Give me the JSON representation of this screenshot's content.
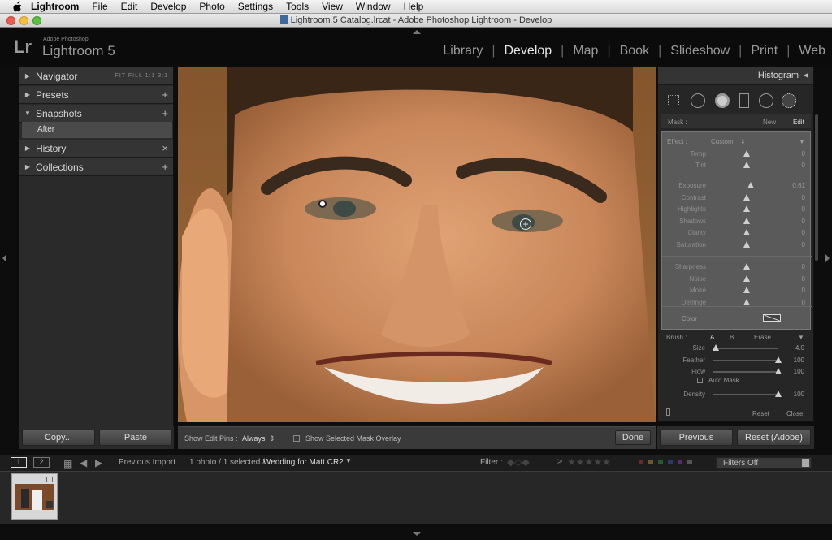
{
  "menubar": {
    "app": "Lightroom",
    "items": [
      "File",
      "Edit",
      "Develop",
      "Photo",
      "Settings",
      "Tools",
      "View",
      "Window",
      "Help"
    ]
  },
  "window": {
    "title": "Lightroom 5 Catalog.lrcat - Adobe Photoshop Lightroom - Develop"
  },
  "logo": {
    "lr": "Lr",
    "sub": "Adobe Photoshop",
    "main": "Lightroom 5"
  },
  "modules": [
    "Library",
    "Develop",
    "Map",
    "Book",
    "Slideshow",
    "Print",
    "Web"
  ],
  "left_panel": {
    "navigator": "Navigator",
    "navigator_opts": "FIT  FILL  1:1  3:1",
    "presets": "Presets",
    "snapshots": "Snapshots",
    "snapshot_item": "After",
    "history": "History",
    "collections": "Collections",
    "copy_label": "Copy...",
    "paste_label": "Paste"
  },
  "right_panel": {
    "histogram": "Histogram",
    "mask_label": "Mask :",
    "mask_new": "New",
    "mask_edit": "Edit",
    "effect_label": "Effect :",
    "effect_value": "Custom",
    "sliders1": [
      {
        "label": "Temp",
        "value": "0",
        "pos": 0.5
      },
      {
        "label": "Tint",
        "value": "0",
        "pos": 0.5
      }
    ],
    "sliders2": [
      {
        "label": "Exposure",
        "value": "0.61",
        "pos": 0.56
      },
      {
        "label": "Contrast",
        "value": "0",
        "pos": 0.5
      },
      {
        "label": "Highlights",
        "value": "0",
        "pos": 0.5
      },
      {
        "label": "Shadows",
        "value": "0",
        "pos": 0.5
      },
      {
        "label": "Clarity",
        "value": "0",
        "pos": 0.5
      },
      {
        "label": "Saturation",
        "value": "0",
        "pos": 0.5
      }
    ],
    "sliders3": [
      {
        "label": "Sharpness",
        "value": "0",
        "pos": 0.5
      },
      {
        "label": "Noise",
        "value": "0",
        "pos": 0.5
      },
      {
        "label": "Moiré",
        "value": "0",
        "pos": 0.5
      },
      {
        "label": "Defringe",
        "value": "0",
        "pos": 0.5
      }
    ],
    "color_label": "Color",
    "brush_label": "Brush :",
    "brush_a": "A",
    "brush_b": "B",
    "brush_erase": "Erase",
    "brush_sliders": [
      {
        "label": "Size",
        "value": "4.0",
        "pos": 0.04
      },
      {
        "label": "Feather",
        "value": "100",
        "pos": 1.0
      },
      {
        "label": "Flow",
        "value": "100",
        "pos": 1.0
      }
    ],
    "auto_mask": "Auto Mask",
    "density": {
      "label": "Density",
      "value": "100",
      "pos": 1.0
    },
    "reset_label": "Reset",
    "close_label": "Close",
    "previous_label": "Previous",
    "reset_adobe_label": "Reset (Adobe)"
  },
  "toolbar": {
    "show_pins_label": "Show Edit Pins :",
    "show_pins_value": "Always",
    "mask_overlay_label": "Show Selected Mask Overlay",
    "done_label": "Done"
  },
  "filmbar": {
    "page1": "1",
    "page2": "2",
    "source": "Previous Import",
    "count": "1 photo / 1 selected /",
    "file": "Wedding for Matt.CR2",
    "filter_label": "Filter :",
    "filters_off": "Filters Off"
  },
  "colors": {
    "accent": "#e8e8e8",
    "panel": "#2a2a2a",
    "photo_skin": "#c48a5a"
  }
}
